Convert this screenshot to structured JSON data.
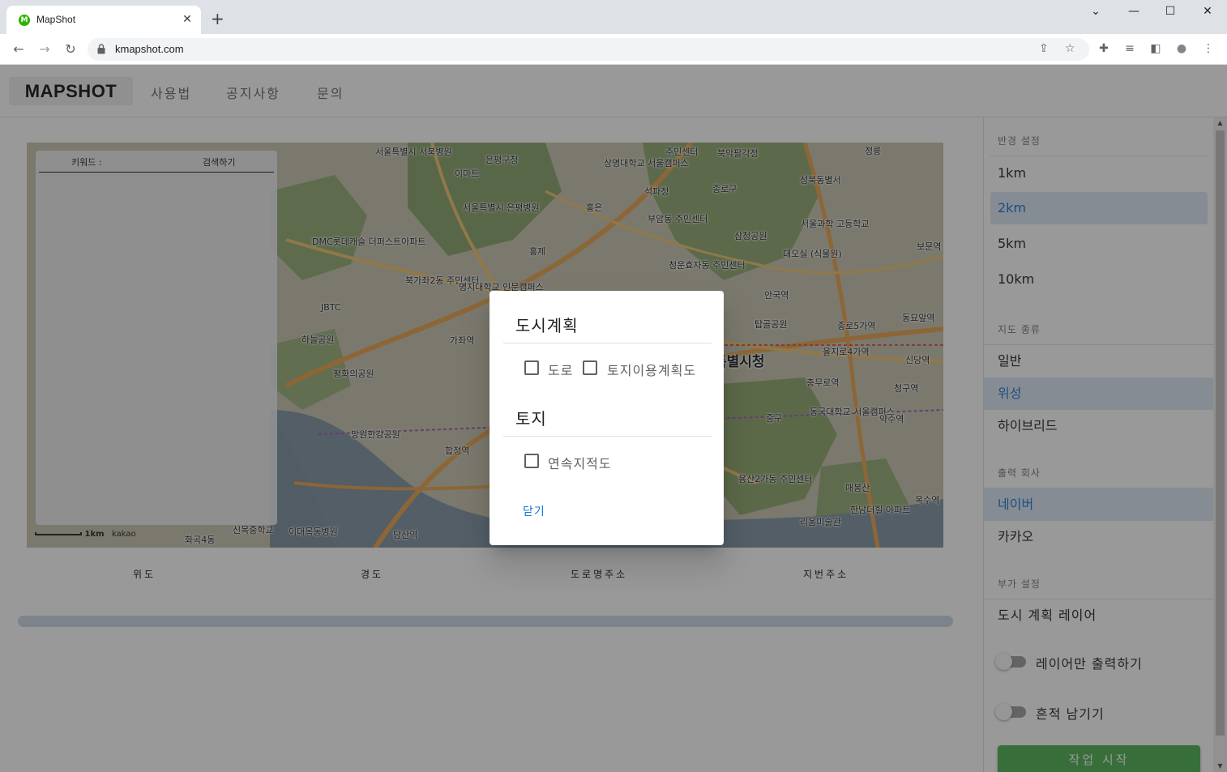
{
  "browser": {
    "tab_title": "MapShot",
    "favicon_letter": "M",
    "tab_close": "✕",
    "new_tab": "+",
    "url": "kmapshot.com",
    "win_chevron": "⌄",
    "win_minimize": "—",
    "win_maximize": "☐",
    "win_close": "✕",
    "back": "←",
    "forward": "→",
    "reload": "↻",
    "share": "⇪",
    "star": "☆",
    "extensions": "✚",
    "media": "≡",
    "sidepanel": "◧",
    "profile": "●",
    "menu": "⋮"
  },
  "app": {
    "logo": "MAPSHOT",
    "nav": [
      "사용법",
      "공지사항",
      "문의"
    ]
  },
  "map": {
    "search_tabs": [
      "키워드 :",
      "검색하기"
    ],
    "scale_text": "1km",
    "brand": "kakao",
    "labels": [
      "서울특별시 서북병원",
      "은평구청",
      "이마트",
      "상명대학교 서울캠퍼스",
      "주민센터",
      "북악팔각정",
      "정릉",
      "서울특별시 은평병원",
      "석파정",
      "종로구",
      "성북동별서",
      "홍은",
      "부암동 주민센터",
      "삼청공원",
      "서울과학 고등학교",
      "DMC롯데캐슬 더퍼스트아파트",
      "북가좌2동 주민센터",
      "명지대학교 인문캠퍼스",
      "청운효자동 주민센터",
      "대오실 (식물원)",
      "보문역",
      "JBTC",
      "홍제",
      "하늘공원",
      "가좌역",
      "탑골공원",
      "종로5가역",
      "동묘앞역",
      "을지로4가역",
      "신당역",
      "평화의공원",
      "특별시청",
      "충무로역",
      "청구역",
      "동국대학교 서울캠퍼스",
      "약수역",
      "중구",
      "망원한강공원",
      "합정역",
      "용산2가동 주민센터",
      "매봉산",
      "한남더힐 아파트",
      "옥수역",
      "이대목동병원",
      "당산역",
      "신목중학교",
      "화곡4동",
      "리움미술관",
      "안국역"
    ]
  },
  "columns": [
    "위도",
    "경도",
    "도로명주소",
    "지번주소"
  ],
  "sidebar": {
    "radius_header": "반경 설정",
    "radius_options": [
      "1km",
      "2km",
      "5km",
      "10km"
    ],
    "maptype_header": "지도 종류",
    "maptype_options": [
      "일반",
      "위성",
      "하이브리드"
    ],
    "company_header": "출력 회사",
    "company_options": [
      "네이버",
      "카카오"
    ],
    "extra_header": "부가 설정",
    "extra_item": "도시 계획 레이어",
    "switch_layer_only": "레이어만 출력하기",
    "switch_trace": "흔적 남기기",
    "start_button": "작업 시작"
  },
  "dialog": {
    "section1_title": "도시계획",
    "cb_road": "도로",
    "cb_landuse": "토지이용계획도",
    "section2_title": "토지",
    "cb_cadastral": "연속지적도",
    "close": "닫기"
  },
  "colors": {
    "selected_bg": "#dce8f6",
    "selected_text": "#1976d2",
    "start_button": "#4caf50",
    "overlay": "rgba(33,33,33,0.46)"
  }
}
